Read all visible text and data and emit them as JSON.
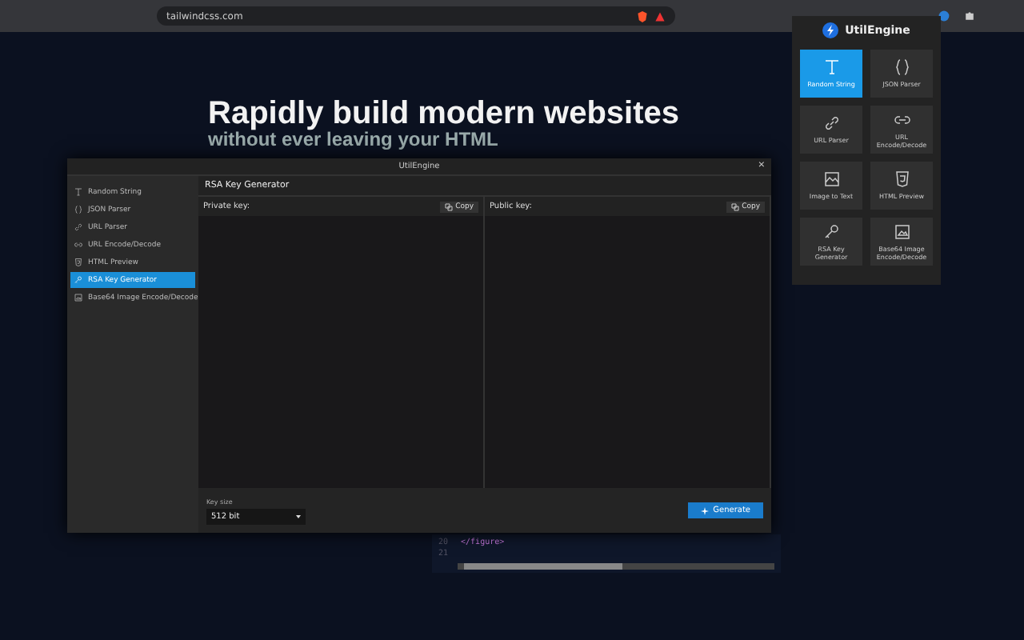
{
  "browser": {
    "url": "tailwindcss.com"
  },
  "page": {
    "headline": [
      "Rapidly build modern websites",
      "without ever leaving your HTML"
    ],
    "code_lines": [
      {
        "number": "20",
        "code": "</figure>"
      },
      {
        "number": "21"
      }
    ]
  },
  "modal": {
    "title": "UtilEngine",
    "close": "×",
    "sidebar": [
      {
        "label": "Random String",
        "selected": false
      },
      {
        "label": "JSON Parser",
        "selected": false
      },
      {
        "label": "URL Parser",
        "selected": false
      },
      {
        "label": "URL Encode/Decode",
        "selected": false
      },
      {
        "label": "HTML Preview",
        "selected": false
      },
      {
        "label": "RSA Key Generator",
        "selected": true
      },
      {
        "label": "Base64 Image Encode/Decode",
        "selected": false
      }
    ],
    "heading": "RSA Key Generator",
    "panes": [
      {
        "label": "Private key:",
        "copy": "Copy"
      },
      {
        "label": "Public key:",
        "copy": "Copy"
      }
    ],
    "key_size": {
      "label": "Key size",
      "value": "512 bit"
    },
    "generate": "Generate"
  },
  "popup": {
    "title": "UtilEngine",
    "tools": [
      {
        "label": "Random String",
        "selected": true
      },
      {
        "label": "JSON Parser",
        "selected": false
      },
      {
        "label": "URL Parser",
        "selected": false
      },
      {
        "label": "URL Encode/Decode",
        "selected": false
      },
      {
        "label": "Image to Text",
        "selected": false
      },
      {
        "label": "HTML Preview",
        "selected": false
      },
      {
        "label": "RSA Key Generator",
        "selected": false
      },
      {
        "label": "Base64 Image Encode/Decode",
        "selected": false
      }
    ]
  }
}
